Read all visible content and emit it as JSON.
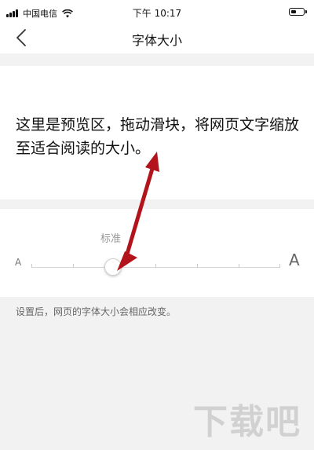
{
  "status_bar": {
    "carrier": "中国电信",
    "time": "下午 10:17"
  },
  "nav": {
    "title": "字体大小"
  },
  "preview": {
    "text": "这里是预览区，拖动滑块，将网页文字缩放至适合阅读的大小。"
  },
  "slider": {
    "current_label": "标准",
    "min_label": "A",
    "max_label": "A",
    "level": 2,
    "levels": 7
  },
  "hint": "设置后，网页的字体大小会相应改变。",
  "watermark": "下载吧",
  "colors": {
    "annotation_arrow": "#b3141c"
  }
}
